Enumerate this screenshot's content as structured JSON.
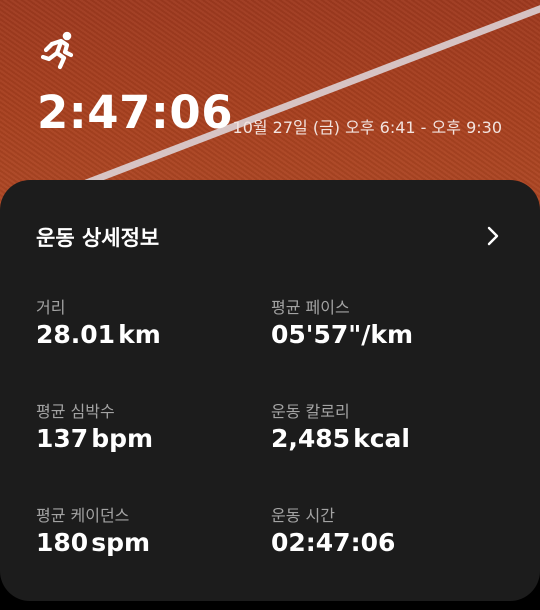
{
  "header": {
    "activity_icon": "running-person-icon",
    "duration": "2:47:06",
    "datetime": "10월 27일 (금) 오후 6:41 - 오후 9:30"
  },
  "details": {
    "title": "운동 상세정보",
    "more_icon": "chevron-right-icon",
    "metrics": [
      {
        "label": "거리",
        "value": "28.01",
        "unit": "km"
      },
      {
        "label": "평균 페이스",
        "value": "05'57\"/km",
        "unit": ""
      },
      {
        "label": "평균 심박수",
        "value": "137",
        "unit": "bpm"
      },
      {
        "label": "운동 칼로리",
        "value": "2,485",
        "unit": "kcal"
      },
      {
        "label": "평균 케이던스",
        "value": "180",
        "unit": "spm"
      },
      {
        "label": "운동 시간",
        "value": "02:47:06",
        "unit": ""
      }
    ]
  },
  "colors": {
    "track": "#a8401f",
    "card": "#1c1c1c",
    "label": "#a3a3a3",
    "value": "#ffffff"
  }
}
